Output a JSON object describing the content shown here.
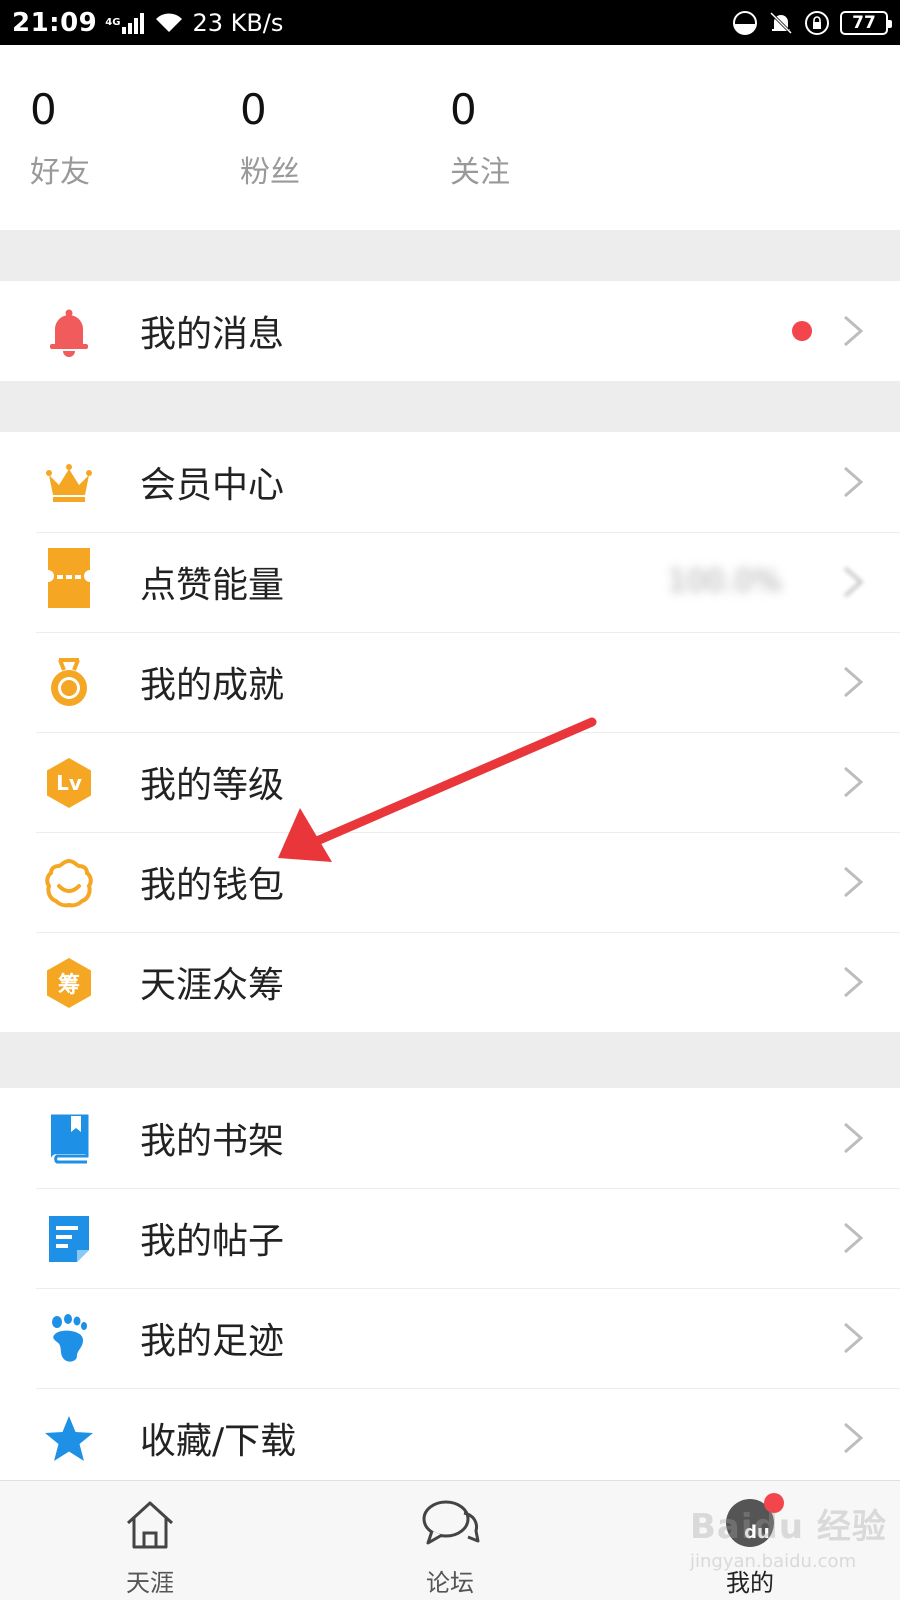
{
  "status_bar": {
    "time": "21:09",
    "network": "4G",
    "speed": "23 KB/s",
    "battery": "77"
  },
  "stats": [
    {
      "value": "0",
      "label": "好友"
    },
    {
      "value": "0",
      "label": "粉丝"
    },
    {
      "value": "0",
      "label": "关注"
    }
  ],
  "menu": {
    "group1": [
      {
        "label": "我的消息",
        "icon": "bell-icon"
      }
    ],
    "group2": [
      {
        "label": "会员中心",
        "icon": "crown-icon"
      },
      {
        "label": "点赞能量",
        "icon": "ticket-icon",
        "value": "100.0%"
      },
      {
        "label": "我的成就",
        "icon": "medal-icon"
      },
      {
        "label": "我的等级",
        "icon": "level-icon",
        "icon_text": "Lv"
      },
      {
        "label": "我的钱包",
        "icon": "wallet-icon"
      },
      {
        "label": "天涯众筹",
        "icon": "crowdfunding-icon",
        "icon_text": "筹"
      }
    ],
    "group3": [
      {
        "label": "我的书架",
        "icon": "book-icon"
      },
      {
        "label": "我的帖子",
        "icon": "post-icon"
      },
      {
        "label": "我的足迹",
        "icon": "footprint-icon"
      },
      {
        "label": "收藏/下载",
        "icon": "star-icon"
      }
    ]
  },
  "bottom_nav": [
    {
      "label": "天涯",
      "icon": "home-icon"
    },
    {
      "label": "论坛",
      "icon": "chat-icon"
    },
    {
      "label": "我的",
      "icon": "avatar-icon",
      "icon_text": "du"
    }
  ],
  "watermark": {
    "text": "Baidu 经验",
    "sub": "jingyan.baidu.com"
  },
  "colors": {
    "accent_orange": "#f5a623",
    "accent_blue": "#1e90e6",
    "alert_red": "#f2454c",
    "bell_red": "#f25b5b"
  }
}
